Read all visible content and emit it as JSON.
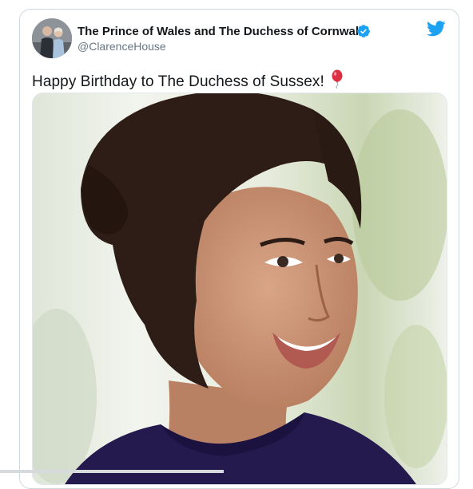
{
  "tweet": {
    "display_name": "The Prince of Wales and The Duchess of Cornwall",
    "handle": "@ClarenceHouse",
    "text": "Happy Birthday to The Duchess of Sussex!",
    "emoji": "balloon-icon",
    "verified": true
  },
  "colors": {
    "verified_blue": "#1da1f2",
    "twitter_blue": "#1da1f2",
    "name_text": "#14171a",
    "handle_text": "#657786",
    "card_border": "#cfd9de"
  },
  "icons": {
    "verified": "verified-badge-icon",
    "brand": "twitter-bird-icon",
    "emoji": "balloon-icon"
  },
  "media": {
    "type": "photo"
  }
}
